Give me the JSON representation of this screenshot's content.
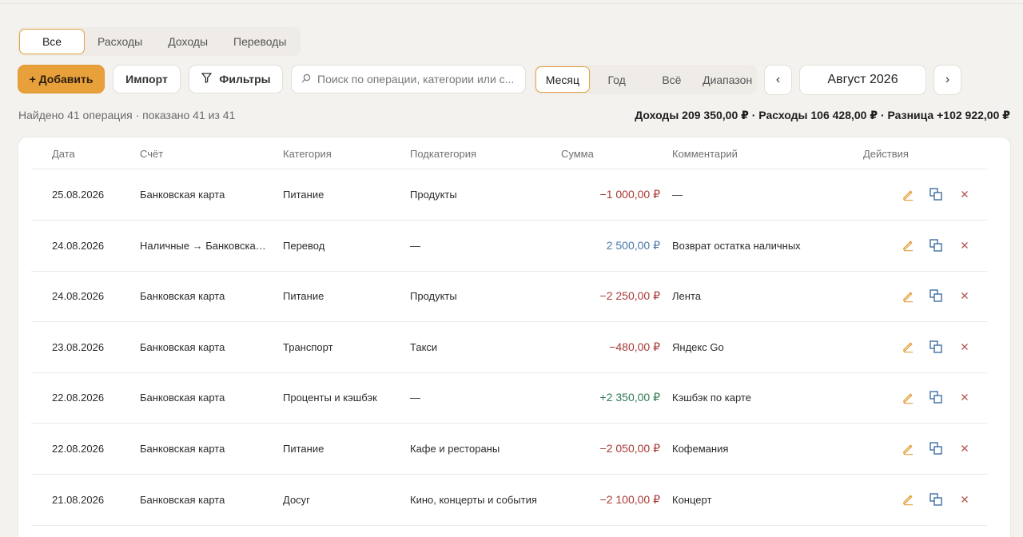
{
  "tabs": [
    {
      "label": "Все",
      "active": true
    },
    {
      "label": "Расходы"
    },
    {
      "label": "Доходы"
    },
    {
      "label": "Переводы"
    }
  ],
  "toolbar": {
    "add_label": "+ Добавить",
    "import_label": "Импорт",
    "filter_label": "Фильтры",
    "search_placeholder": "Поиск по операции, категории или с..."
  },
  "periods": [
    "Месяц",
    "Год",
    "Всё",
    "Диапазон"
  ],
  "month": {
    "label": "Август 2026",
    "prev": "‹",
    "next": "›"
  },
  "summary": {
    "found": "Найдено 41 операция · показано 41 из 41",
    "totals": "Доходы 209 350,00 ₽ · Расходы 106 428,00 ₽ · Разница +102 922,00 ₽"
  },
  "table": {
    "headers": [
      "Дата",
      "Счёт",
      "Категория",
      "Подкатегория",
      "Сумма",
      "Комментарий",
      "Действия"
    ],
    "rows": [
      {
        "date": "25.08.2026",
        "account": "Банковская карта",
        "category": "Питание",
        "subcategory": "Продукты",
        "amount": "−1 000,00 ₽",
        "kind": "neg",
        "comment": "—"
      },
      {
        "date": "24.08.2026",
        "account": "Наличные → Банковская ...",
        "category": "Перевод",
        "subcategory": "—",
        "amount": "2 500,00 ₽",
        "kind": "trf",
        "comment": "Возврат остатка наличных"
      },
      {
        "date": "24.08.2026",
        "account": "Банковская карта",
        "category": "Питание",
        "subcategory": "Продукты",
        "amount": "−2 250,00 ₽",
        "kind": "neg",
        "comment": "Лента"
      },
      {
        "date": "23.08.2026",
        "account": "Банковская карта",
        "category": "Транспорт",
        "subcategory": "Такси",
        "amount": "−480,00 ₽",
        "kind": "neg",
        "comment": "Яндекс Go"
      },
      {
        "date": "22.08.2026",
        "account": "Банковская карта",
        "category": "Проценты и кэшбэк",
        "subcategory": "—",
        "amount": "+2 350,00 ₽",
        "kind": "pos",
        "comment": "Кэшбэк по карте"
      },
      {
        "date": "22.08.2026",
        "account": "Банковская карта",
        "category": "Питание",
        "subcategory": "Кафе и рестораны",
        "amount": "−2 050,00 ₽",
        "kind": "neg",
        "comment": "Кофемания"
      },
      {
        "date": "21.08.2026",
        "account": "Банковская карта",
        "category": "Досуг",
        "subcategory": "Кино, концерты и события",
        "amount": "−2 100,00 ₽",
        "kind": "neg",
        "comment": "Концерт"
      }
    ]
  },
  "icons": {
    "edit": "pencil-icon",
    "copy": "copy-icon",
    "delete": "close-icon",
    "filter": "filter-icon",
    "search": "search-icon"
  },
  "colors": {
    "accent": "#e8a03a",
    "negative": "#a83a36",
    "positive": "#2f7a52",
    "transfer": "#4a78a8",
    "copy_icon": "#3f6ea3",
    "delete_icon": "#b65a55"
  }
}
